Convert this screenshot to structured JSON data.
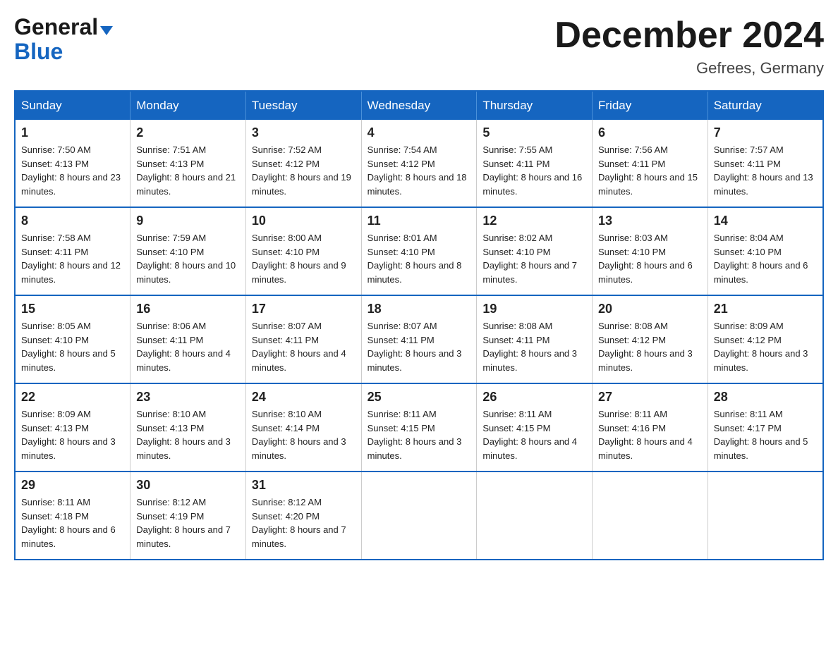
{
  "header": {
    "logo_line1": "General",
    "logo_line2": "Blue",
    "title": "December 2024",
    "location": "Gefrees, Germany"
  },
  "columns": [
    "Sunday",
    "Monday",
    "Tuesday",
    "Wednesday",
    "Thursday",
    "Friday",
    "Saturday"
  ],
  "weeks": [
    [
      {
        "day": "1",
        "sunrise": "7:50 AM",
        "sunset": "4:13 PM",
        "daylight": "8 hours and 23 minutes."
      },
      {
        "day": "2",
        "sunrise": "7:51 AM",
        "sunset": "4:13 PM",
        "daylight": "8 hours and 21 minutes."
      },
      {
        "day": "3",
        "sunrise": "7:52 AM",
        "sunset": "4:12 PM",
        "daylight": "8 hours and 19 minutes."
      },
      {
        "day": "4",
        "sunrise": "7:54 AM",
        "sunset": "4:12 PM",
        "daylight": "8 hours and 18 minutes."
      },
      {
        "day": "5",
        "sunrise": "7:55 AM",
        "sunset": "4:11 PM",
        "daylight": "8 hours and 16 minutes."
      },
      {
        "day": "6",
        "sunrise": "7:56 AM",
        "sunset": "4:11 PM",
        "daylight": "8 hours and 15 minutes."
      },
      {
        "day": "7",
        "sunrise": "7:57 AM",
        "sunset": "4:11 PM",
        "daylight": "8 hours and 13 minutes."
      }
    ],
    [
      {
        "day": "8",
        "sunrise": "7:58 AM",
        "sunset": "4:11 PM",
        "daylight": "8 hours and 12 minutes."
      },
      {
        "day": "9",
        "sunrise": "7:59 AM",
        "sunset": "4:10 PM",
        "daylight": "8 hours and 10 minutes."
      },
      {
        "day": "10",
        "sunrise": "8:00 AM",
        "sunset": "4:10 PM",
        "daylight": "8 hours and 9 minutes."
      },
      {
        "day": "11",
        "sunrise": "8:01 AM",
        "sunset": "4:10 PM",
        "daylight": "8 hours and 8 minutes."
      },
      {
        "day": "12",
        "sunrise": "8:02 AM",
        "sunset": "4:10 PM",
        "daylight": "8 hours and 7 minutes."
      },
      {
        "day": "13",
        "sunrise": "8:03 AM",
        "sunset": "4:10 PM",
        "daylight": "8 hours and 6 minutes."
      },
      {
        "day": "14",
        "sunrise": "8:04 AM",
        "sunset": "4:10 PM",
        "daylight": "8 hours and 6 minutes."
      }
    ],
    [
      {
        "day": "15",
        "sunrise": "8:05 AM",
        "sunset": "4:10 PM",
        "daylight": "8 hours and 5 minutes."
      },
      {
        "day": "16",
        "sunrise": "8:06 AM",
        "sunset": "4:11 PM",
        "daylight": "8 hours and 4 minutes."
      },
      {
        "day": "17",
        "sunrise": "8:07 AM",
        "sunset": "4:11 PM",
        "daylight": "8 hours and 4 minutes."
      },
      {
        "day": "18",
        "sunrise": "8:07 AM",
        "sunset": "4:11 PM",
        "daylight": "8 hours and 3 minutes."
      },
      {
        "day": "19",
        "sunrise": "8:08 AM",
        "sunset": "4:11 PM",
        "daylight": "8 hours and 3 minutes."
      },
      {
        "day": "20",
        "sunrise": "8:08 AM",
        "sunset": "4:12 PM",
        "daylight": "8 hours and 3 minutes."
      },
      {
        "day": "21",
        "sunrise": "8:09 AM",
        "sunset": "4:12 PM",
        "daylight": "8 hours and 3 minutes."
      }
    ],
    [
      {
        "day": "22",
        "sunrise": "8:09 AM",
        "sunset": "4:13 PM",
        "daylight": "8 hours and 3 minutes."
      },
      {
        "day": "23",
        "sunrise": "8:10 AM",
        "sunset": "4:13 PM",
        "daylight": "8 hours and 3 minutes."
      },
      {
        "day": "24",
        "sunrise": "8:10 AM",
        "sunset": "4:14 PM",
        "daylight": "8 hours and 3 minutes."
      },
      {
        "day": "25",
        "sunrise": "8:11 AM",
        "sunset": "4:15 PM",
        "daylight": "8 hours and 3 minutes."
      },
      {
        "day": "26",
        "sunrise": "8:11 AM",
        "sunset": "4:15 PM",
        "daylight": "8 hours and 4 minutes."
      },
      {
        "day": "27",
        "sunrise": "8:11 AM",
        "sunset": "4:16 PM",
        "daylight": "8 hours and 4 minutes."
      },
      {
        "day": "28",
        "sunrise": "8:11 AM",
        "sunset": "4:17 PM",
        "daylight": "8 hours and 5 minutes."
      }
    ],
    [
      {
        "day": "29",
        "sunrise": "8:11 AM",
        "sunset": "4:18 PM",
        "daylight": "8 hours and 6 minutes."
      },
      {
        "day": "30",
        "sunrise": "8:12 AM",
        "sunset": "4:19 PM",
        "daylight": "8 hours and 7 minutes."
      },
      {
        "day": "31",
        "sunrise": "8:12 AM",
        "sunset": "4:20 PM",
        "daylight": "8 hours and 7 minutes."
      },
      null,
      null,
      null,
      null
    ]
  ]
}
